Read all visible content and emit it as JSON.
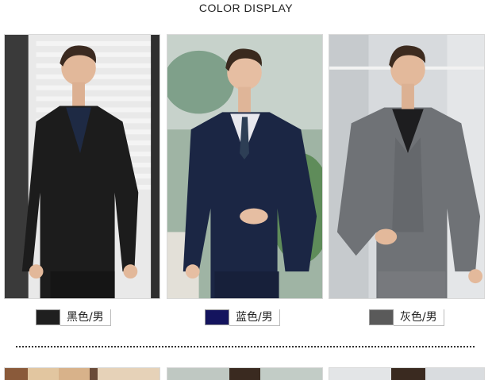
{
  "header": {
    "title": "COLOR DISPLAY"
  },
  "variants": [
    {
      "label": "黑色/男",
      "swatch_color": "#1f1f1f"
    },
    {
      "label": "蓝色/男",
      "swatch_color": "#14145e"
    },
    {
      "label": "灰色/男",
      "swatch_color": "#5a5a5a"
    }
  ],
  "colors": {
    "black_suit": "#1c1c1c",
    "navy_suit": "#1b2644",
    "gray_suit": "#6f7276"
  }
}
